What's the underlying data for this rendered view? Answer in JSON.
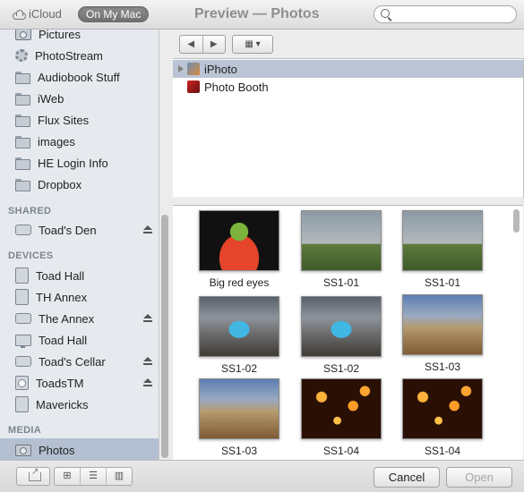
{
  "titlebar": {
    "icloud": "iCloud",
    "on_my_mac": "On My Mac",
    "title": "Preview — Photos",
    "search_placeholder": ""
  },
  "sidebar": {
    "top_items": [
      {
        "label": "Pictures",
        "icon": "camera-icon"
      },
      {
        "label": "PhotoStream",
        "icon": "gear-icon"
      },
      {
        "label": "Audiobook Stuff",
        "icon": "folder-icon"
      },
      {
        "label": "iWeb",
        "icon": "folder-icon"
      },
      {
        "label": "Flux Sites",
        "icon": "folder-icon"
      },
      {
        "label": "images",
        "icon": "folder-icon"
      },
      {
        "label": "HE Login Info",
        "icon": "folder-icon"
      },
      {
        "label": "Dropbox",
        "icon": "folder-icon"
      }
    ],
    "shared_header": "SHARED",
    "shared_items": [
      {
        "label": "Toad's Den",
        "icon": "drive-icon",
        "eject": true
      }
    ],
    "devices_header": "DEVICES",
    "devices_items": [
      {
        "label": "Toad Hall",
        "icon": "hdd-icon",
        "eject": false
      },
      {
        "label": "TH Annex",
        "icon": "hdd-icon",
        "eject": false
      },
      {
        "label": "The Annex",
        "icon": "drive-icon",
        "eject": true
      },
      {
        "label": "Toad Hall",
        "icon": "display-icon",
        "eject": false
      },
      {
        "label": "Toad's Cellar",
        "icon": "drive-icon",
        "eject": true
      },
      {
        "label": "ToadsTM",
        "icon": "clock-icon",
        "eject": true
      },
      {
        "label": "Mavericks",
        "icon": "hdd-icon",
        "eject": false
      }
    ],
    "media_header": "MEDIA",
    "media_items": [
      {
        "label": "Photos",
        "icon": "camera-icon",
        "selected": true
      }
    ]
  },
  "browser": {
    "rows": [
      {
        "label": "iPhoto",
        "selected": true
      },
      {
        "label": "Photo Booth",
        "selected": false
      }
    ]
  },
  "photos": [
    {
      "caption": "Big red eyes"
    },
    {
      "caption": "SS1-01"
    },
    {
      "caption": "SS1-01"
    },
    {
      "caption": "SS1-02"
    },
    {
      "caption": "SS1-02"
    },
    {
      "caption": "SS1-03"
    },
    {
      "caption": "SS1-03"
    },
    {
      "caption": "SS1-04"
    },
    {
      "caption": "SS1-04"
    }
  ],
  "buttons": {
    "cancel": "Cancel",
    "open": "Open"
  },
  "colors": {
    "sidebar_bg": "#e6eaef",
    "selection": "#b4c0d2",
    "disabled_text": "#a6a6a6"
  }
}
